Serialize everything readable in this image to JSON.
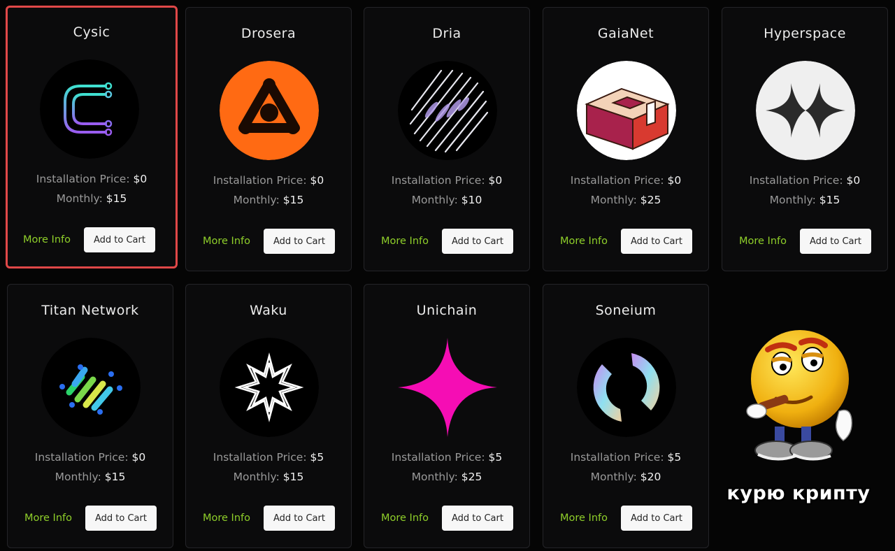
{
  "labels": {
    "installation_price": "Installation Price:",
    "monthly": "Monthly:",
    "more_info": "More Info",
    "add_to_cart": "Add to Cart"
  },
  "products": [
    {
      "name": "Cysic",
      "install": "$0",
      "monthly": "$15",
      "selected": true,
      "logo_icon": "cysic-logo-icon"
    },
    {
      "name": "Drosera",
      "install": "$0",
      "monthly": "$15",
      "logo_icon": "drosera-logo-icon"
    },
    {
      "name": "Dria",
      "install": "$0",
      "monthly": "$10",
      "logo_icon": "dria-logo-icon"
    },
    {
      "name": "GaiaNet",
      "install": "$0",
      "monthly": "$25",
      "logo_icon": "gaianet-logo-icon"
    },
    {
      "name": "Hyperspace",
      "install": "$0",
      "monthly": "$15",
      "logo_icon": "hyperspace-logo-icon"
    },
    {
      "name": "Titan Network",
      "install": "$0",
      "monthly": "$15",
      "logo_icon": "titan-network-logo-icon"
    },
    {
      "name": "Waku",
      "install": "$5",
      "monthly": "$15",
      "logo_icon": "waku-logo-icon"
    },
    {
      "name": "Unichain",
      "install": "$5",
      "monthly": "$25",
      "logo_icon": "unichain-logo-icon"
    },
    {
      "name": "Soneium",
      "install": "$5",
      "monthly": "$20",
      "logo_icon": "soneium-logo-icon"
    }
  ],
  "sticker": {
    "caption": "курю крипту",
    "icon": "smoking-emoji-sticker"
  },
  "colors": {
    "background": "#050505",
    "card": "#0b0b0c",
    "selected_border": "#e04848",
    "more_info": "#8fcf2a",
    "button_bg": "#f7f7f7"
  }
}
